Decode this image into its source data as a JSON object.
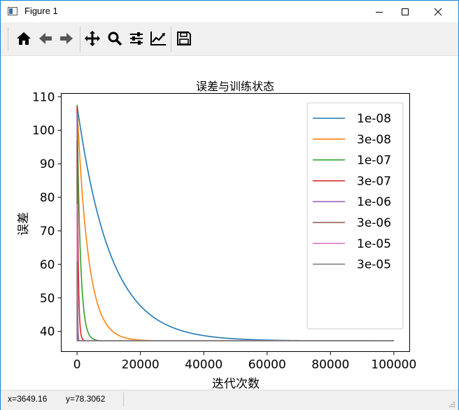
{
  "window": {
    "title": "Figure 1",
    "controls": [
      "minimize",
      "maximize",
      "close"
    ]
  },
  "toolbar": {
    "buttons": [
      {
        "name": "home-icon",
        "tooltip": "Home"
      },
      {
        "name": "back-arrow-icon",
        "tooltip": "Back"
      },
      {
        "name": "forward-arrow-icon",
        "tooltip": "Forward"
      },
      {
        "name": "pan-icon",
        "tooltip": "Pan"
      },
      {
        "name": "zoom-icon",
        "tooltip": "Zoom"
      },
      {
        "name": "subplots-icon",
        "tooltip": "Subplots"
      },
      {
        "name": "edit-axis-icon",
        "tooltip": "Customize"
      },
      {
        "name": "save-icon",
        "tooltip": "Save"
      }
    ]
  },
  "status": {
    "x": "x=3649.16",
    "y": "y=78.3062"
  },
  "chart_data": {
    "type": "line",
    "title": "误差与训练状态",
    "xlabel": "迭代次数",
    "ylabel": "误差",
    "xlim": [
      -5000,
      105000
    ],
    "ylim": [
      34,
      111
    ],
    "xticks": [
      0,
      20000,
      40000,
      60000,
      80000,
      100000
    ],
    "xtick_labels": [
      "0",
      "20000",
      "40000",
      "60000",
      "80000",
      "100000"
    ],
    "yticks": [
      40,
      50,
      60,
      70,
      80,
      90,
      100,
      110
    ],
    "ytick_labels": [
      "40",
      "50",
      "60",
      "70",
      "80",
      "90",
      "100",
      "110"
    ],
    "legend_position": "upper right",
    "grid": false,
    "asymptote": 37.2,
    "series": [
      {
        "name": "1e-08",
        "color": "#1f77b4",
        "start": 107.5,
        "tau": 10500
      },
      {
        "name": "3e-08",
        "color": "#ff7f0e",
        "start": 107.5,
        "tau": 3500
      },
      {
        "name": "1e-07",
        "color": "#2ca02c",
        "start": 107.5,
        "tau": 1050
      },
      {
        "name": "3e-07",
        "color": "#d62728",
        "start": 107.0,
        "tau": 350
      },
      {
        "name": "1e-06",
        "color": "#9467bd",
        "start": 105.0,
        "tau": 105
      },
      {
        "name": "3e-06",
        "color": "#8c564b",
        "start": 97.0,
        "tau": 35
      },
      {
        "name": "1e-05",
        "color": "#e377c2",
        "start": 78.0,
        "tau": 11
      },
      {
        "name": "3e-05",
        "color": "#7f7f7f",
        "start": 61.0,
        "tau": 4
      }
    ]
  }
}
